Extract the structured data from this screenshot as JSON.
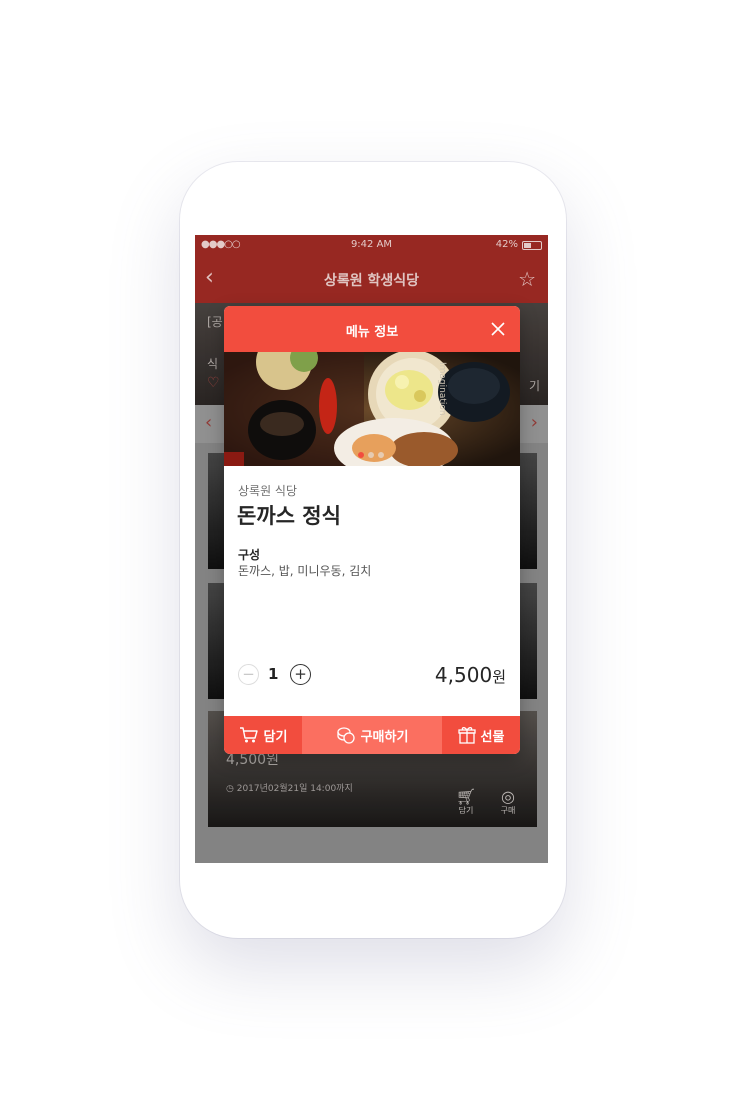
{
  "status_bar": {
    "signal": "●●●○○",
    "time": "9:42 AM",
    "battery": "42%"
  },
  "nav": {
    "back_glyph": "‹",
    "title": "상록원 학생식당",
    "star_glyph": "☆"
  },
  "background": {
    "hero_line1": "[공",
    "hero_line2": "식",
    "hero_heart": "♡",
    "hero_right": "기",
    "prev_glyph": "‹",
    "next_glyph": "›",
    "card_price": "4,500원",
    "card_deadline": "2017년02월21일 14:00까지",
    "card_cart_label": "담기",
    "card_buy_label": "구매"
  },
  "modal": {
    "title": "메뉴 정보",
    "photo_watermark": "Imagination",
    "restaurant": "상록원 식당",
    "menu_name": "돈까스 정식",
    "composition_label": "구성",
    "composition_items": "돈까스, 밥, 미니우동, 김치",
    "quantity": "1",
    "minus_glyph": "−",
    "plus_glyph": "+",
    "price_number": "4,500",
    "price_unit": "원",
    "carousel": {
      "count": 3,
      "active_index": 0
    },
    "actions": {
      "cart": "담기",
      "buy": "구매하기",
      "gift": "선물"
    }
  },
  "colors": {
    "accent": "#f24d3e",
    "nav": "#a12b25",
    "buy_button": "#fb6f60"
  }
}
